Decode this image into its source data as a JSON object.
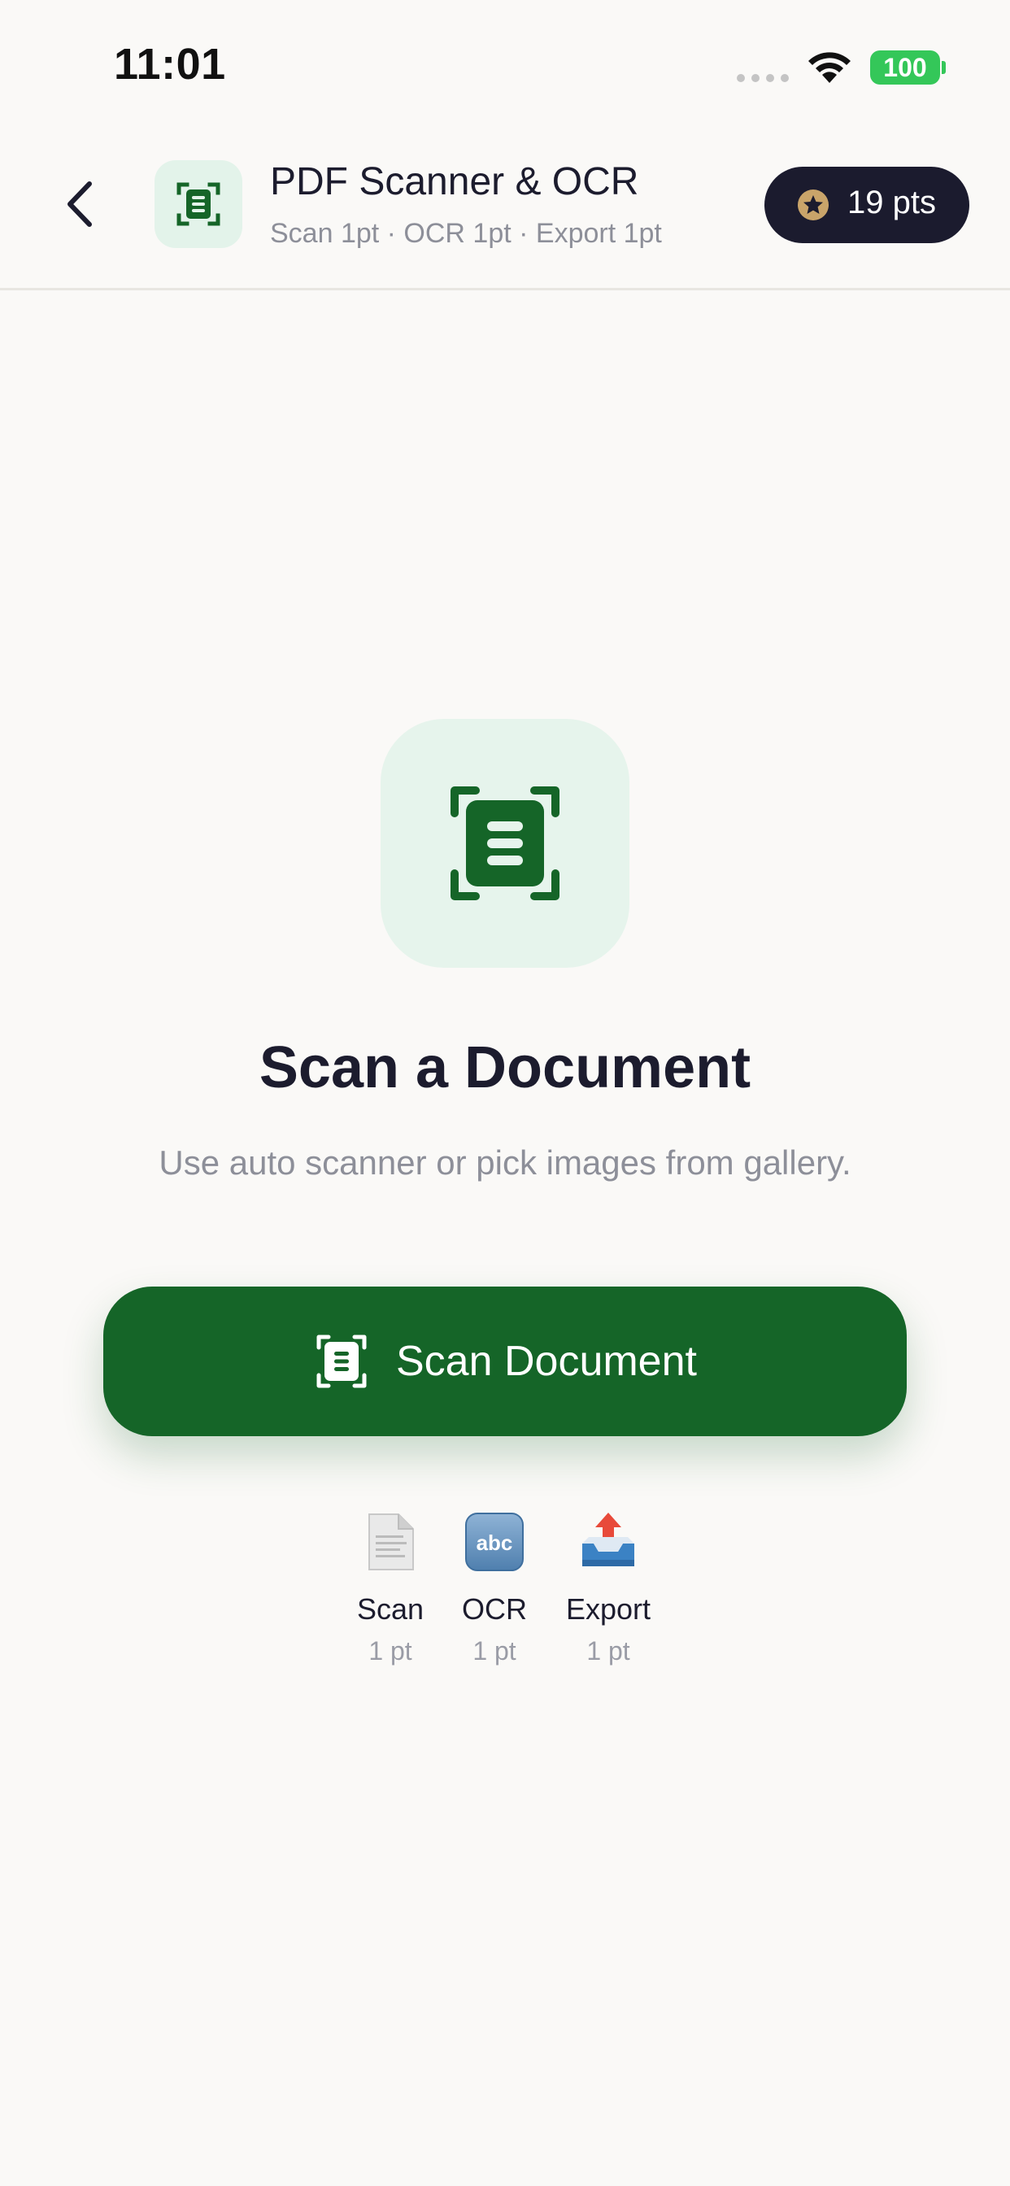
{
  "status_bar": {
    "time": "11:01",
    "battery": "100"
  },
  "header": {
    "title": "PDF Scanner & OCR",
    "subtitle": "Scan 1pt · OCR 1pt · Export 1pt",
    "points": "19 pts",
    "icon": "document-scanner-icon"
  },
  "main": {
    "title": "Scan a Document",
    "subtitle": "Use auto scanner or pick images from gallery.",
    "button_label": "Scan Document",
    "icon": "document-scanner-icon"
  },
  "costs": [
    {
      "name": "Scan",
      "value": "1 pt",
      "icon": "page-icon"
    },
    {
      "name": "OCR",
      "value": "1 pt",
      "icon": "abc-icon"
    },
    {
      "name": "Export",
      "value": "1 pt",
      "icon": "outbox-tray-icon"
    }
  ],
  "colors": {
    "accent": "#156528",
    "accent_light": "#e6f4ec",
    "pill_dark": "#1b1b2e",
    "battery": "#34c759",
    "background": "#faf9f7"
  }
}
